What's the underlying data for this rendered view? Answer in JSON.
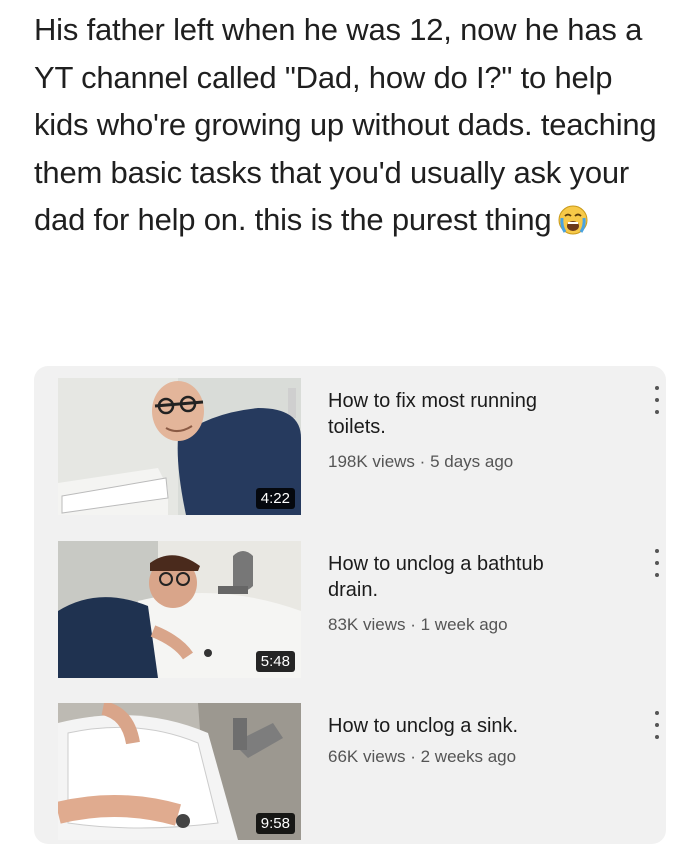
{
  "post": {
    "text": "His father left when he was 12, now he has a YT channel called \"Dad, how do I?\" to help kids who're growing up without dads. teaching them basic tasks that you'd usually ask your dad for help on. this is the purest thing",
    "emoji": "loudly-crying-face"
  },
  "videos": [
    {
      "title": "How to fix most running toilets.",
      "views": "198K views",
      "age": "5 days ago",
      "duration": "4:22"
    },
    {
      "title": "How to unclog a bathtub drain.",
      "views": "83K views",
      "age": "1 week ago",
      "duration": "5:48"
    },
    {
      "title": "How to unclog a sink.",
      "views": "66K views",
      "age": "2 weeks ago",
      "duration": "9:58"
    }
  ],
  "meta_separator": "·"
}
